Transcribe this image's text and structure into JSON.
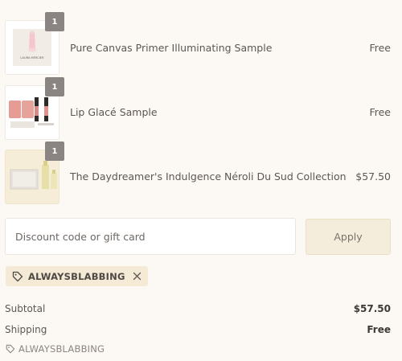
{
  "cart": {
    "items": [
      {
        "name": "Pure Canvas Primer Illuminating Sample",
        "quantity": "1",
        "price": "Free",
        "thumb_text": "LAURA MERCIER"
      },
      {
        "name": "Lip Glacé Sample",
        "quantity": "1",
        "price": "Free"
      },
      {
        "name": "The Daydreamer's Indulgence Néroli Du Sud Collection",
        "quantity": "1",
        "price": "$57.50"
      }
    ]
  },
  "discount": {
    "placeholder": "Discount code or gift card",
    "value": "",
    "apply_label": "Apply",
    "applied_tag": "ALWAYSBLABBING"
  },
  "summary": {
    "subtotal_label": "Subtotal",
    "subtotal_value": "$57.50",
    "shipping_label": "Shipping",
    "shipping_value": "Free",
    "discount_code": "ALWAYSBLABBING"
  },
  "colors": {
    "background": "#fcf8f4",
    "quantity_badge": "#8a8483",
    "apply_button": "#f5eddb",
    "tag_background": "#f4ead6"
  },
  "icons": [
    "tag-icon",
    "close-icon"
  ]
}
